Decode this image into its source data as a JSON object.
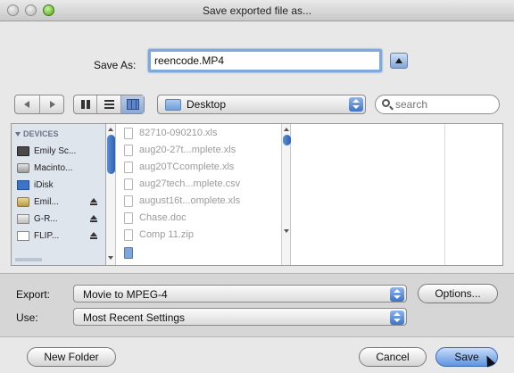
{
  "window": {
    "title": "Save exported file as..."
  },
  "save_as": {
    "label": "Save As:",
    "value": "reencode.MP4"
  },
  "toolbar": {
    "location": "Desktop",
    "search_placeholder": "search"
  },
  "sidebar": {
    "section": "DEVICES",
    "items": [
      {
        "label": "Emily Sc...",
        "icon": "laptop-icon"
      },
      {
        "label": "Macinto...",
        "icon": "hard-drive-icon"
      },
      {
        "label": "iDisk",
        "icon": "idisk-icon"
      },
      {
        "label": "Emil...",
        "icon": "network-icon"
      },
      {
        "label": "G-R...",
        "icon": "external-drive-icon"
      },
      {
        "label": "FLIP...",
        "icon": "drive-icon"
      }
    ]
  },
  "files": [
    {
      "name": "82710-090210.xls"
    },
    {
      "name": "aug20-27t...mplete.xls"
    },
    {
      "name": "aug20TCcomplete.xls"
    },
    {
      "name": "aug27tech...mplete.csv"
    },
    {
      "name": "august16t...omplete.xls"
    },
    {
      "name": "Chase.doc"
    },
    {
      "name": "Comp 11.zip"
    }
  ],
  "export": {
    "label": "Export:",
    "value": "Movie to MPEG-4",
    "options_label": "Options..."
  },
  "use": {
    "label": "Use:",
    "value": "Most Recent Settings"
  },
  "buttons": {
    "new_folder": "New Folder",
    "cancel": "Cancel",
    "save": "Save"
  },
  "colors": {
    "accent": "#5f93e0",
    "focus_ring": "#7fa8dc"
  }
}
